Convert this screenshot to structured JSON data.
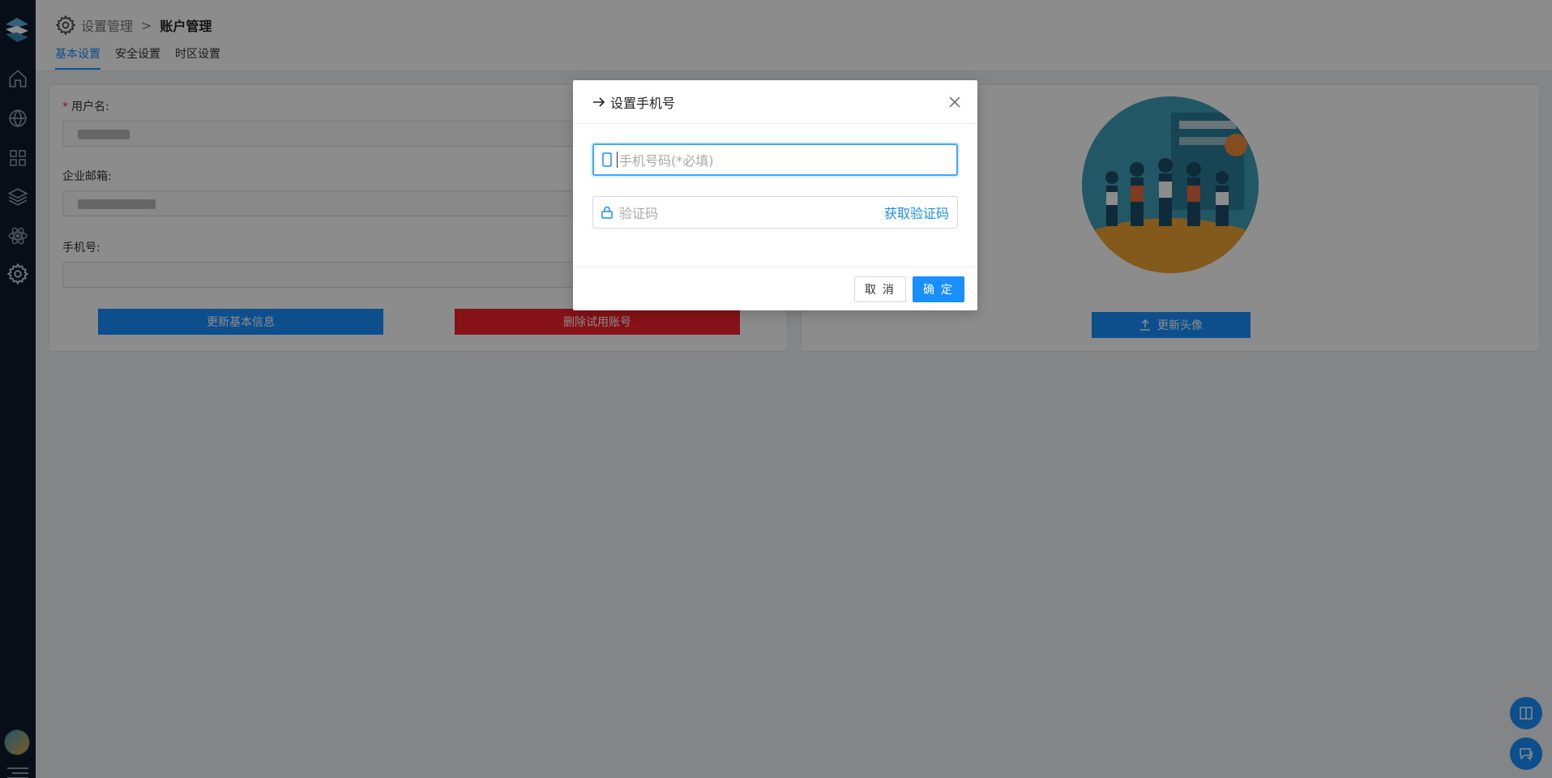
{
  "breadcrumb": {
    "parent": "设置管理",
    "separator": ">",
    "current": "账户管理"
  },
  "tabs": [
    {
      "label": "基本设置",
      "active": true
    },
    {
      "label": "安全设置",
      "active": false
    },
    {
      "label": "时区设置",
      "active": false
    }
  ],
  "form": {
    "username_label": "用户名:",
    "email_label": "企业邮箱:",
    "phone_label": "手机号:",
    "update_basic_button": "更新基本信息",
    "delete_trial_button": "删除试用账号"
  },
  "avatar_card": {
    "update_avatar_button": "更新头像"
  },
  "modal": {
    "title": "设置手机号",
    "phone_placeholder": "手机号码(*必填)",
    "code_placeholder": "验证码",
    "get_code_link": "获取验证码",
    "cancel_button": "取 消",
    "ok_button": "确 定"
  },
  "colors": {
    "primary": "#1890ff",
    "danger": "#f5222d",
    "sidebar": "#0f1b2d"
  },
  "icons": [
    "logo-icon",
    "home-icon",
    "globe-icon",
    "apps-icon",
    "layers-icon",
    "atom-icon",
    "gear-icon",
    "book-icon",
    "chat-icon",
    "upload-icon",
    "phone-icon",
    "lock-icon",
    "close-icon",
    "arrow-right-icon",
    "menu-icon"
  ]
}
